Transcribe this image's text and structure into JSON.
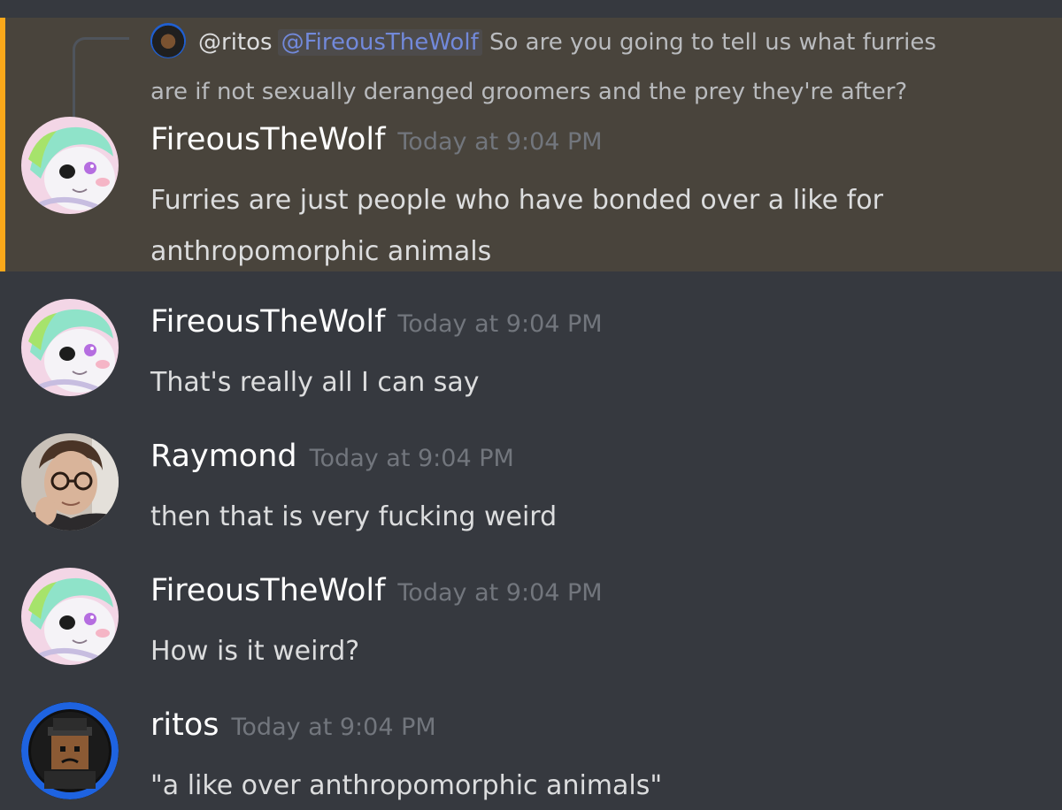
{
  "colors": {
    "background": "#36393f",
    "highlight_background": "#49443c",
    "highlight_bar": "#faa81a",
    "mention": "#7289da",
    "username": "#ffffff",
    "timestamp": "#72767d",
    "text": "#dcddde"
  },
  "reply": {
    "author": "@ritos",
    "mention": "@FireousTheWolf",
    "text_first": "So are you going to tell us what furries",
    "text_second": "are if not sexually deranged groomers and the prey they're after?"
  },
  "messages": [
    {
      "author": "FireousTheWolf",
      "timestamp": "Today at 9:04 PM",
      "line1": "Furries are just people who have bonded over a like for",
      "line2": "anthropomorphic animals"
    },
    {
      "author": "FireousTheWolf",
      "timestamp": "Today at 9:04 PM",
      "line1": "That's really all I can say"
    },
    {
      "author": "Raymond",
      "timestamp": "Today at 9:04 PM",
      "line1": "then that is very fucking weird"
    },
    {
      "author": "FireousTheWolf",
      "timestamp": "Today at 9:04 PM",
      "line1": "How is it weird?"
    },
    {
      "author": "ritos",
      "timestamp": "Today at 9:04 PM",
      "line1": "\"a like over anthropomorphic animals\""
    }
  ]
}
